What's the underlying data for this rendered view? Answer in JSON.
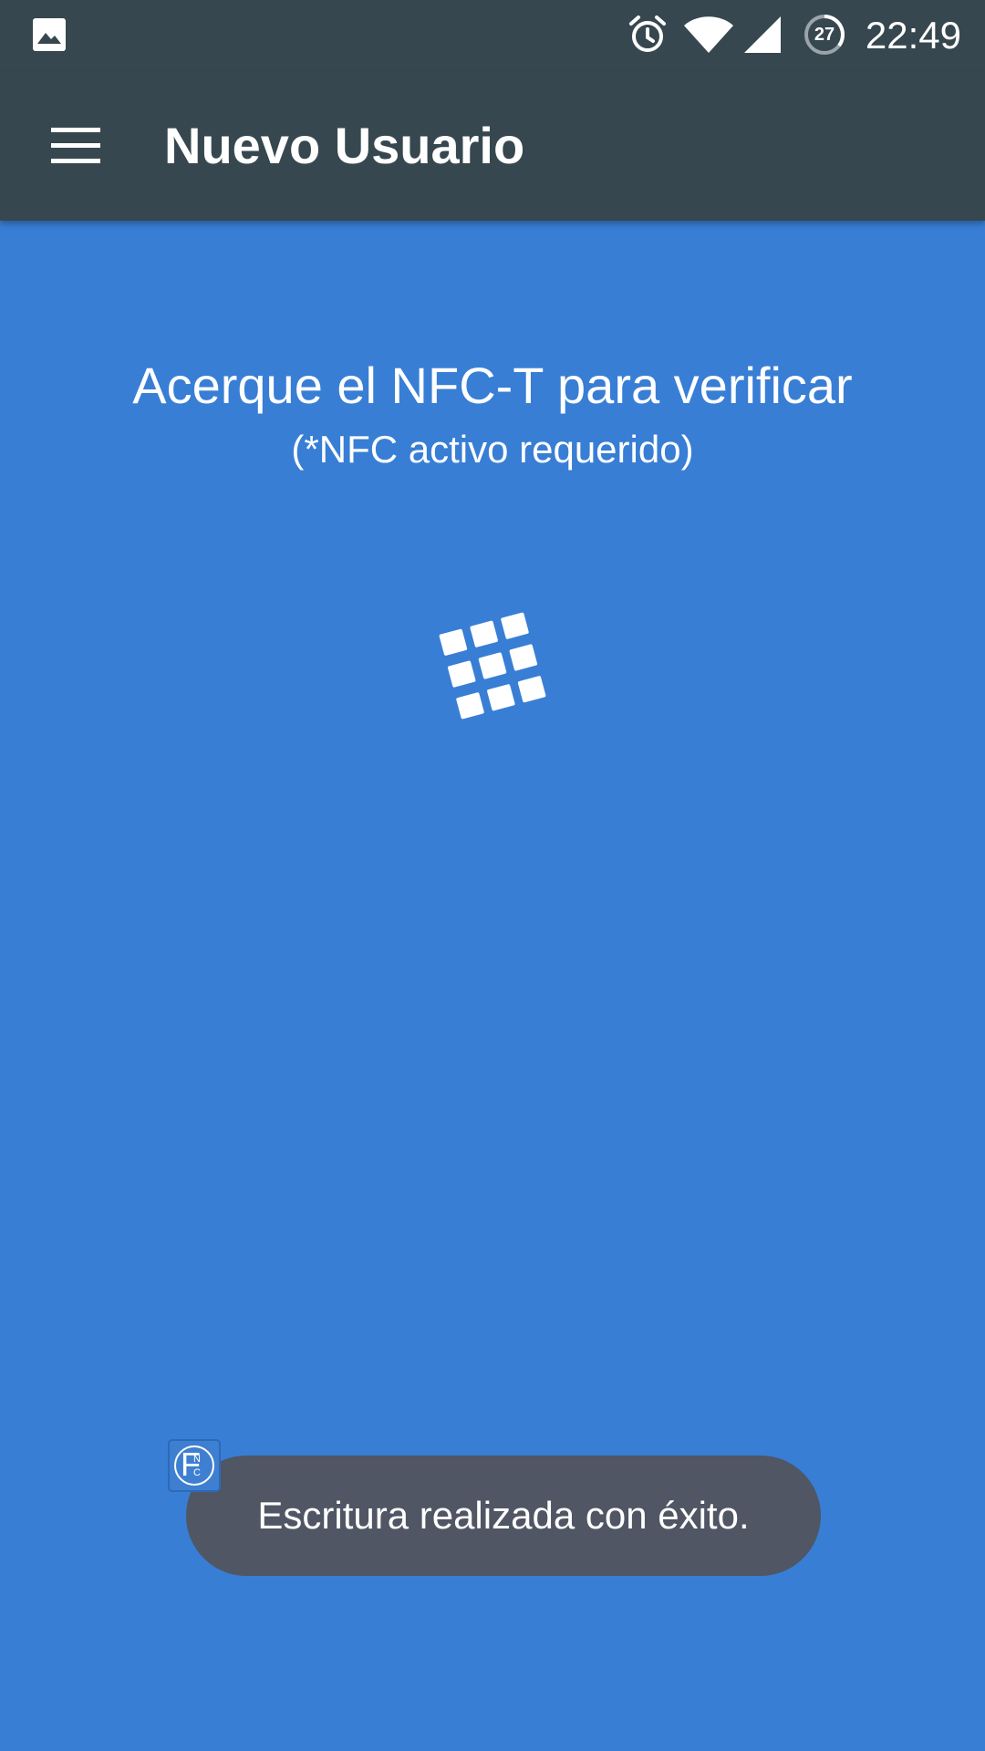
{
  "status_bar": {
    "time": "22:49",
    "notification_badge": "27",
    "icons": [
      "gallery-icon",
      "alarm-icon",
      "wifi-icon",
      "signal-icon",
      "battery-saver-icon"
    ]
  },
  "app_bar": {
    "title": "Nuevo Usuario",
    "menu_icon": "hamburger-menu-icon"
  },
  "main": {
    "headline": "Acerque el NFC-T para verificar",
    "subline": "(*NFC activo requerido)",
    "spinner_icon": "grid-loading-icon"
  },
  "toast": {
    "message": "Escritura realizada con éxito.",
    "app_icon_letters": {
      "big": "F",
      "top": "N",
      "bottom": "C"
    }
  },
  "colors": {
    "status_bar": "#37474f",
    "app_bar": "#37474f",
    "background": "#387ed5",
    "toast": "#505663",
    "text": "#ffffff"
  }
}
